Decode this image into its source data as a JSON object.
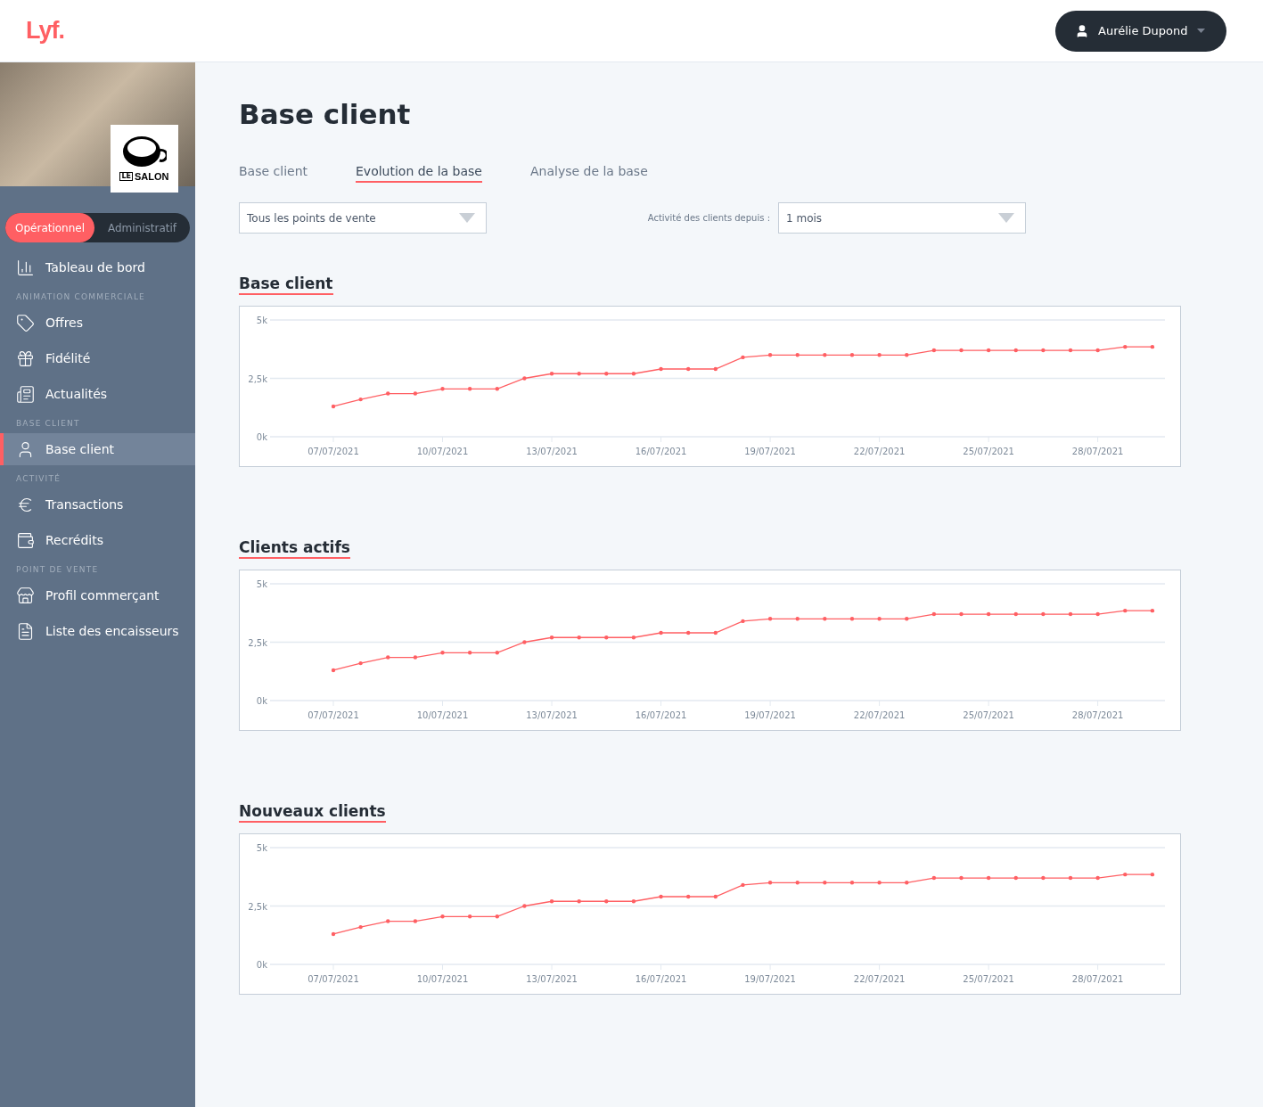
{
  "header": {
    "logo": "Lyf.",
    "user": {
      "name": "Aurélie Dupond"
    }
  },
  "sidebar": {
    "store_logo": {
      "small": "LE",
      "name": "SALON"
    },
    "modes": [
      {
        "label": "Opérationnel",
        "selected": true
      },
      {
        "label": "Administratif",
        "selected": false
      }
    ],
    "sections": [
      {
        "items": [
          {
            "label": "Tableau de bord",
            "selected": false
          }
        ]
      },
      {
        "title": "ANIMATION COMMERCIALE",
        "items": [
          {
            "label": "Offres",
            "selected": false
          },
          {
            "label": "Fidélité",
            "selected": false
          },
          {
            "label": "Actualités",
            "selected": false
          }
        ]
      },
      {
        "title": "BASE CLIENT",
        "items": [
          {
            "label": "Base client",
            "selected": true
          }
        ]
      },
      {
        "title": "ACTIVITÉ",
        "items": [
          {
            "label": "Transactions",
            "selected": false
          },
          {
            "label": "Recrédits",
            "selected": false
          }
        ]
      },
      {
        "title": "POINT DE VENTE",
        "items": [
          {
            "label": "Profil commerçant",
            "selected": false
          },
          {
            "label": "Liste des encaisseurs",
            "selected": false
          }
        ]
      }
    ]
  },
  "page": {
    "title": "Base client",
    "tabs": [
      {
        "label": "Base client",
        "selected": false
      },
      {
        "label": "Evolution de la base",
        "selected": true
      },
      {
        "label": "Analyse de la base",
        "selected": false
      }
    ],
    "store_select": {
      "value": "Tous les points de vente"
    },
    "activity": {
      "label": "Activité des clients depuis :",
      "value": "1 mois"
    },
    "charts": [
      {
        "title": "Base client",
        "chart_data": {
          "type": "line",
          "categories": [
            "07/07/2021",
            null,
            null,
            null,
            "10/07/2021",
            null,
            null,
            null,
            "13/07/2021",
            null,
            null,
            null,
            "16/07/2021",
            null,
            null,
            null,
            "19/07/2021",
            null,
            null,
            null,
            "22/07/2021",
            null,
            null,
            null,
            "25/07/2021",
            null,
            null,
            null,
            "28/07/2021",
            null,
            null
          ],
          "series": [
            {
              "color": "#ff5f63",
              "values": [
                1300,
                1600,
                1850,
                1850,
                2050,
                2050,
                2050,
                2500,
                2700,
                2700,
                2700,
                2700,
                2900,
                2900,
                2900,
                3400,
                3500,
                3500,
                3500,
                3500,
                3500,
                3500,
                3700,
                3700,
                3700,
                3700,
                3700,
                3700,
                3700,
                3850,
                3850
              ]
            }
          ],
          "ylim": [
            0,
            5000
          ],
          "yticks": [
            {
              "value": 0,
              "label": "0k"
            },
            {
              "value": 2500,
              "label": "2,5k"
            },
            {
              "value": 5000,
              "label": "5k"
            }
          ]
        }
      },
      {
        "title": "Clients actifs",
        "chart_data": {
          "type": "line",
          "categories": [
            "07/07/2021",
            null,
            null,
            null,
            "10/07/2021",
            null,
            null,
            null,
            "13/07/2021",
            null,
            null,
            null,
            "16/07/2021",
            null,
            null,
            null,
            "19/07/2021",
            null,
            null,
            null,
            "22/07/2021",
            null,
            null,
            null,
            "25/07/2021",
            null,
            null,
            null,
            "28/07/2021",
            null,
            null
          ],
          "series": [
            {
              "color": "#ff5f63",
              "values": [
                1300,
                1600,
                1850,
                1850,
                2050,
                2050,
                2050,
                2500,
                2700,
                2700,
                2700,
                2700,
                2900,
                2900,
                2900,
                3400,
                3500,
                3500,
                3500,
                3500,
                3500,
                3500,
                3700,
                3700,
                3700,
                3700,
                3700,
                3700,
                3700,
                3850,
                3850
              ]
            }
          ],
          "ylim": [
            0,
            5000
          ],
          "yticks": [
            {
              "value": 0,
              "label": "0k"
            },
            {
              "value": 2500,
              "label": "2,5k"
            },
            {
              "value": 5000,
              "label": "5k"
            }
          ]
        }
      },
      {
        "title": "Nouveaux clients",
        "chart_data": {
          "type": "line",
          "categories": [
            "07/07/2021",
            null,
            null,
            null,
            "10/07/2021",
            null,
            null,
            null,
            "13/07/2021",
            null,
            null,
            null,
            "16/07/2021",
            null,
            null,
            null,
            "19/07/2021",
            null,
            null,
            null,
            "22/07/2021",
            null,
            null,
            null,
            "25/07/2021",
            null,
            null,
            null,
            "28/07/2021",
            null,
            null
          ],
          "series": [
            {
              "color": "#ff5f63",
              "values": [
                1300,
                1600,
                1850,
                1850,
                2050,
                2050,
                2050,
                2500,
                2700,
                2700,
                2700,
                2700,
                2900,
                2900,
                2900,
                3400,
                3500,
                3500,
                3500,
                3500,
                3500,
                3500,
                3700,
                3700,
                3700,
                3700,
                3700,
                3700,
                3700,
                3850,
                3850
              ]
            }
          ],
          "ylim": [
            0,
            5000
          ],
          "yticks": [
            {
              "value": 0,
              "label": "0k"
            },
            {
              "value": 2500,
              "label": "2,5k"
            },
            {
              "value": 5000,
              "label": "5k"
            }
          ]
        }
      }
    ]
  }
}
